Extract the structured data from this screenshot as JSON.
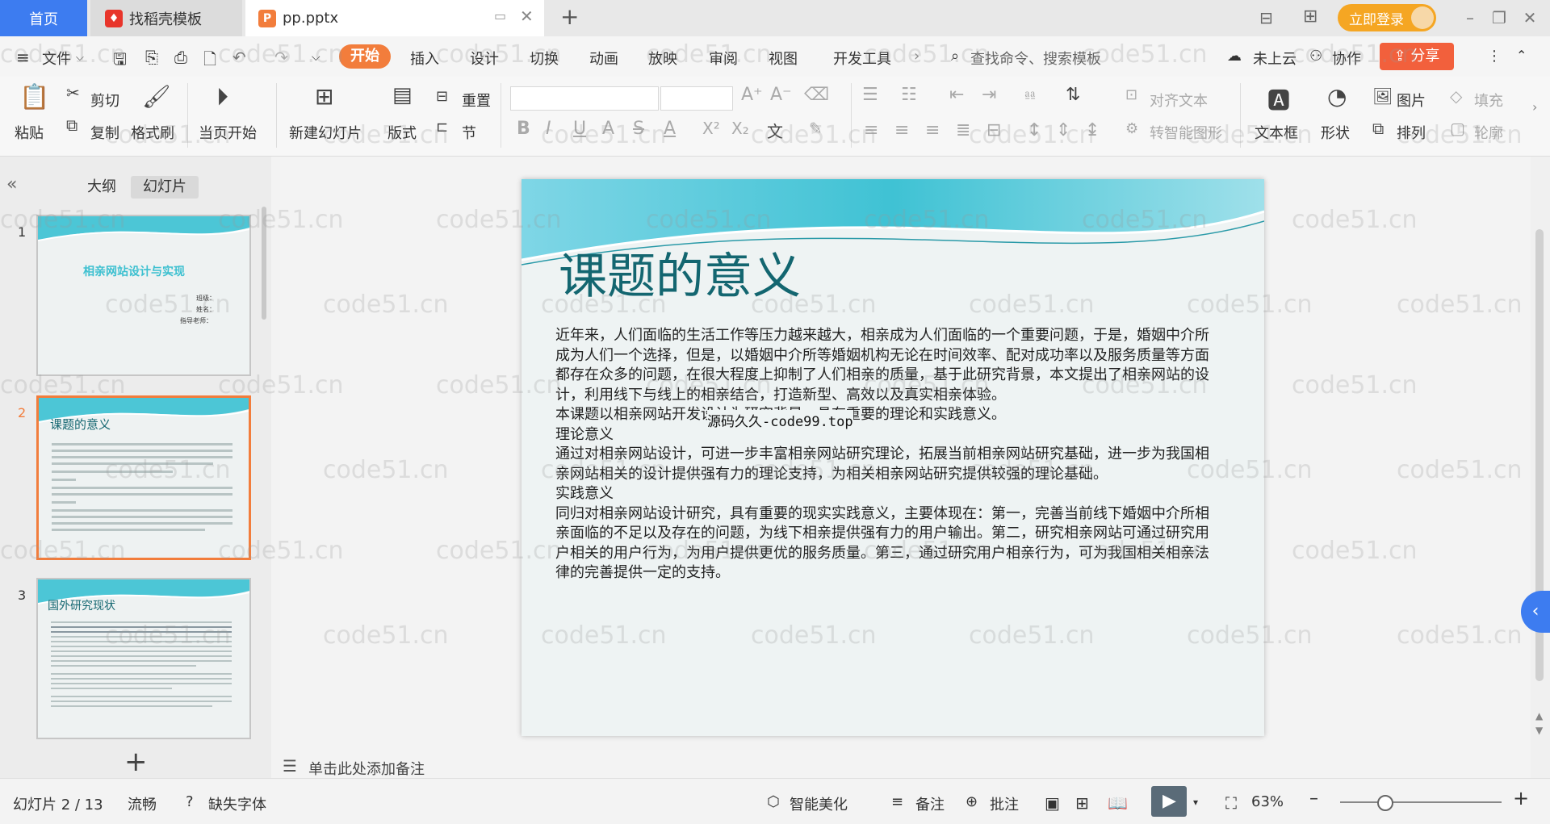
{
  "titlebar": {
    "tabs": [
      {
        "label": "首页"
      },
      {
        "label": "找稻壳模板"
      },
      {
        "label": "pp.pptx"
      }
    ],
    "login_label": "立即登录"
  },
  "menubar": {
    "file_label": "文件",
    "items": [
      "开始",
      "插入",
      "设计",
      "切换",
      "动画",
      "放映",
      "审阅",
      "视图",
      "开发工具"
    ],
    "search_placeholder": "查找命令、搜索模板",
    "cloud_label": "未上云",
    "collab_label": "协作",
    "share_label": "分享"
  },
  "ribbon": {
    "paste": "粘贴",
    "cut": "剪切",
    "copy": "复制",
    "format_painter": "格式刷",
    "from_current": "当页开始",
    "new_slide": "新建幻灯片",
    "layout": "版式",
    "reset": "重置",
    "section": "节",
    "align_text": "对齐文本",
    "smart_art": "转智能图形",
    "textbox": "文本框",
    "shape": "形状",
    "picture": "图片",
    "fill": "填充",
    "arrange": "排列",
    "outline": "轮廓"
  },
  "leftpane": {
    "tab_outline": "大纲",
    "tab_slides": "幻灯片",
    "thumbs": [
      {
        "num": "1",
        "title": "相亲网站设计与实现",
        "lines": [
          "班级：",
          "姓名：",
          "指导老师："
        ]
      },
      {
        "num": "2",
        "title": "课题的意义"
      },
      {
        "num": "3",
        "title": "国外研究现状"
      }
    ],
    "add_label": "+"
  },
  "slide": {
    "title": "课题的意义",
    "paragraphs": [
      "近年来，人们面临的生活工作等压力越来越大，相亲成为人们面临的一个重要问题，于是，婚姻中介所成为人们一个选择，但是，以婚姻中介所等婚姻机构无论在时间效率、配对成功率以及服务质量等方面都存在众多的问题，在很大程度上抑制了人们相亲的质量，基于此研究背景，本文提出了相亲网站的设计，利用线下与线上的相亲结合，打造新型、高效以及真实相亲体验。",
      "本课题以相亲网站开发设计为研究背景，具有重要的理论和实践意义。",
      "理论意义",
      "通过对相亲网站设计，可进一步丰富相亲网站研究理论，拓展当前相亲网站研究基础，进一步为我国相亲网站相关的设计提供强有力的理论支持，为相关相亲网站研究提供较强的理论基础。",
      "实践意义",
      "同归对相亲网站设计研究，具有重要的现实实践意义，主要体现在：第一，完善当前线下婚姻中介所相亲面临的不足以及存在的问题，为线下相亲提供强有力的用户输出。第二，研究相亲网站可通过研究用户相关的用户行为，为用户提供更优的服务质量。第三，通过研究用户相亲行为，可为我国相关相亲法律的完善提供一定的支持。"
    ],
    "overlay_text": "源码久久-code99.top"
  },
  "notes_placeholder": "单击此处添加备注",
  "status": {
    "slide_counter": "幻灯片 2 / 13",
    "theme": "流畅",
    "missing_font": "缺失字体",
    "beautify": "智能美化",
    "notes": "备注",
    "comment": "批注",
    "zoom": "63%"
  },
  "watermark": "code51.cn",
  "colors": {
    "accent": "#f27d3c",
    "title_teal": "#136670",
    "tab_blue": "#3d7cf0"
  }
}
